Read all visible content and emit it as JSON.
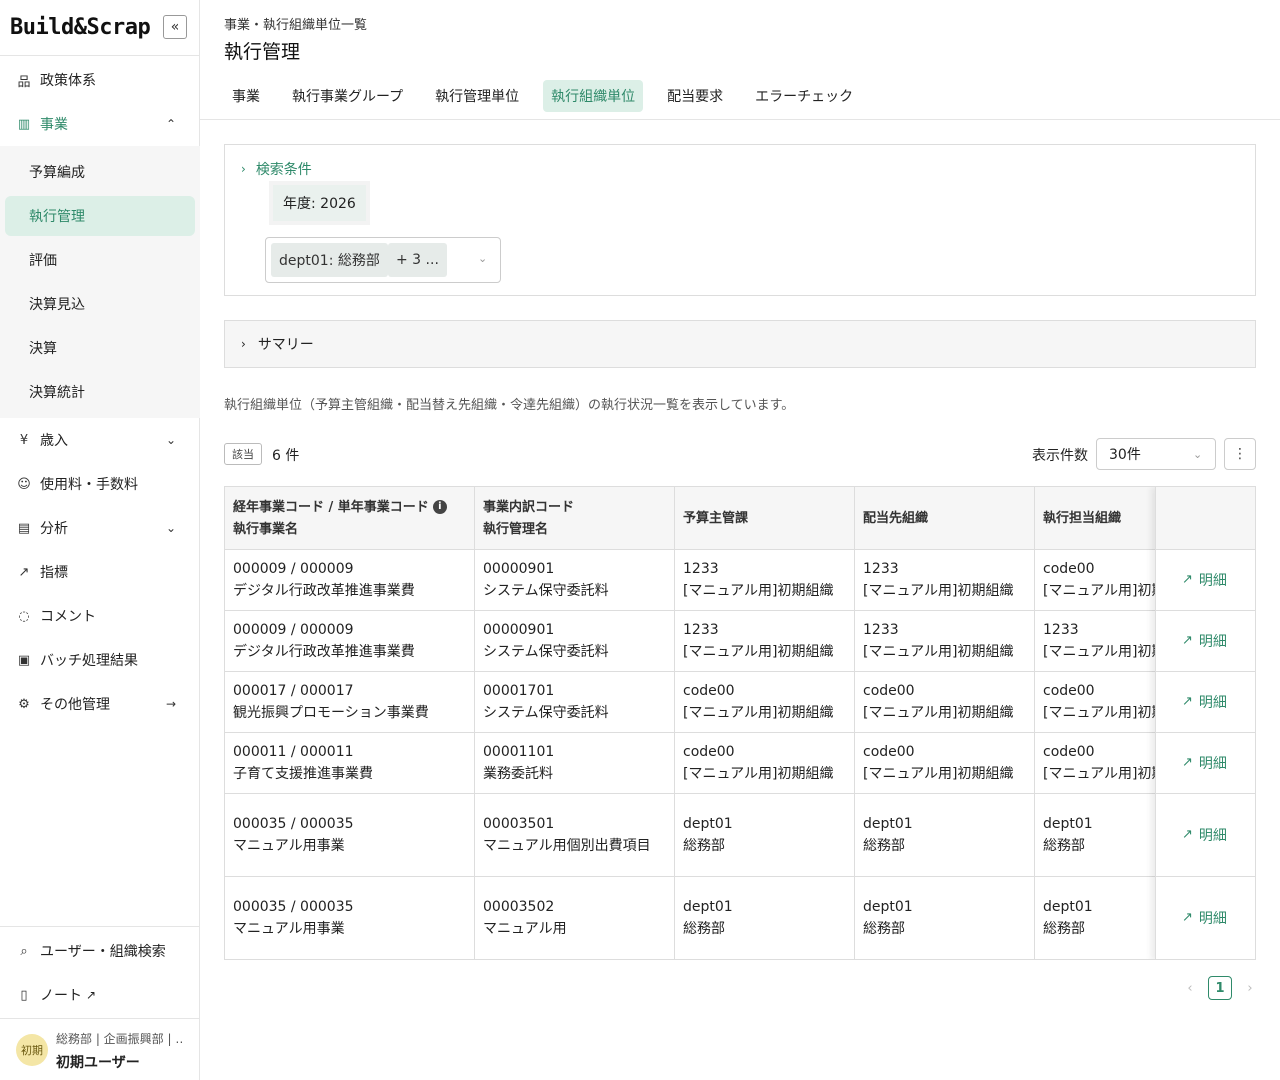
{
  "app": {
    "logo": "Build&Scrap",
    "collapse_icon": "«"
  },
  "sidebar": {
    "items": [
      {
        "label": "政策体系",
        "icon": "sitemap-icon",
        "glyph": "品"
      },
      {
        "label": "事業",
        "icon": "bar-chart-icon",
        "glyph": "▥"
      },
      {
        "label": "歳入",
        "icon": "yen-doc-icon",
        "glyph": "¥"
      },
      {
        "label": "使用料・手数料",
        "icon": "person-coin-icon",
        "glyph": "☺"
      },
      {
        "label": "分析",
        "icon": "analysis-icon",
        "glyph": "▤"
      },
      {
        "label": "指標",
        "icon": "trend-icon",
        "glyph": "↗"
      },
      {
        "label": "コメント",
        "icon": "comment-icon",
        "glyph": "◌"
      },
      {
        "label": "バッチ処理結果",
        "icon": "terminal-icon",
        "glyph": "▣"
      },
      {
        "label": "その他管理",
        "icon": "gear-icon",
        "glyph": "⚙"
      }
    ],
    "sub_items": [
      "予算編成",
      "執行管理",
      "評価",
      "決算見込",
      "決算",
      "決算統計"
    ],
    "bottom": [
      {
        "label": "ユーザー・組織検索",
        "icon": "search-icon",
        "glyph": "⌕"
      },
      {
        "label": "ノート",
        "icon": "book-icon",
        "glyph": "▯"
      }
    ],
    "user": {
      "avatar": "初期",
      "dept": "総務部 | 企画振興部 | …",
      "name": "初期ユーザー"
    }
  },
  "header": {
    "breadcrumb": "事業・執行組織単位一覧",
    "title": "執行管理",
    "tabs": [
      "事業",
      "執行事業グループ",
      "執行管理単位",
      "執行組織単位",
      "配当要求",
      "エラーチェック"
    ],
    "active_tab": 3
  },
  "search": {
    "title": "検索条件",
    "year_tag": "年度: 2026",
    "dept_tag": "dept01: 総務部",
    "more_tag": "+ 3 ..."
  },
  "summary": {
    "title": "サマリー"
  },
  "description": "執行組織単位（予算主管組織・配当替え先組織・令達先組織）の執行状況一覧を表示しています。",
  "result": {
    "badge": "該当",
    "count": "6 件",
    "per_page_label": "表示件数",
    "per_page_value": "30件"
  },
  "table": {
    "headers": [
      {
        "line1": "経年事業コード / 単年事業コード",
        "line2": "執行事業名"
      },
      {
        "line1": "事業内訳コード",
        "line2": "執行管理名"
      },
      {
        "line1": "予算主管課",
        "line2": ""
      },
      {
        "line1": "配当先組織",
        "line2": ""
      },
      {
        "line1": "執行担当組織",
        "line2": ""
      }
    ],
    "detail_label": "明細",
    "rows": [
      {
        "c1a": "000009 / 000009",
        "c1b": "デジタル行政改革推進事業費",
        "c2a": "00000901",
        "c2b": "システム保守委託料",
        "c3a": "1233",
        "c3b": "[マニュアル用]初期組織",
        "c4a": "1233",
        "c4b": "[マニュアル用]初期組織",
        "c5a": "code00",
        "c5b": "[マニュアル用]初期組織"
      },
      {
        "c1a": "000009 / 000009",
        "c1b": "デジタル行政改革推進事業費",
        "c2a": "00000901",
        "c2b": "システム保守委託料",
        "c3a": "1233",
        "c3b": "[マニュアル用]初期組織",
        "c4a": "1233",
        "c4b": "[マニュアル用]初期組織",
        "c5a": "1233",
        "c5b": "[マニュアル用]初期組織"
      },
      {
        "c1a": "000017 / 000017",
        "c1b": "観光振興プロモーション事業費",
        "c2a": "00001701",
        "c2b": "システム保守委託料",
        "c3a": "code00",
        "c3b": "[マニュアル用]初期組織",
        "c4a": "code00",
        "c4b": "[マニュアル用]初期組織",
        "c5a": "code00",
        "c5b": "[マニュアル用]初期組織"
      },
      {
        "c1a": "000011 / 000011",
        "c1b": "子育て支援推進事業費",
        "c2a": "00001101",
        "c2b": "業務委託料",
        "c3a": "code00",
        "c3b": "[マニュアル用]初期組織",
        "c4a": "code00",
        "c4b": "[マニュアル用]初期組織",
        "c5a": "code00",
        "c5b": "[マニュアル用]初期組織"
      },
      {
        "c1a": "000035 / 000035",
        "c1b": "マニュアル用事業",
        "c2a": "00003501",
        "c2b": "マニュアル用個別出費項目",
        "c3a": "dept01",
        "c3b": "総務部",
        "c4a": "dept01",
        "c4b": "総務部",
        "c5a": "dept01",
        "c5b": "総務部"
      },
      {
        "c1a": "000035 / 000035",
        "c1b": "マニュアル用事業",
        "c2a": "00003502",
        "c2b": "マニュアル用",
        "c3a": "dept01",
        "c3b": "総務部",
        "c4a": "dept01",
        "c4b": "総務部",
        "c5a": "dept01",
        "c5b": "総務部"
      }
    ]
  },
  "pagination": {
    "current": "1"
  },
  "colors": {
    "accent": "#2f8a6a",
    "accent_bg": "#dcefe7"
  }
}
